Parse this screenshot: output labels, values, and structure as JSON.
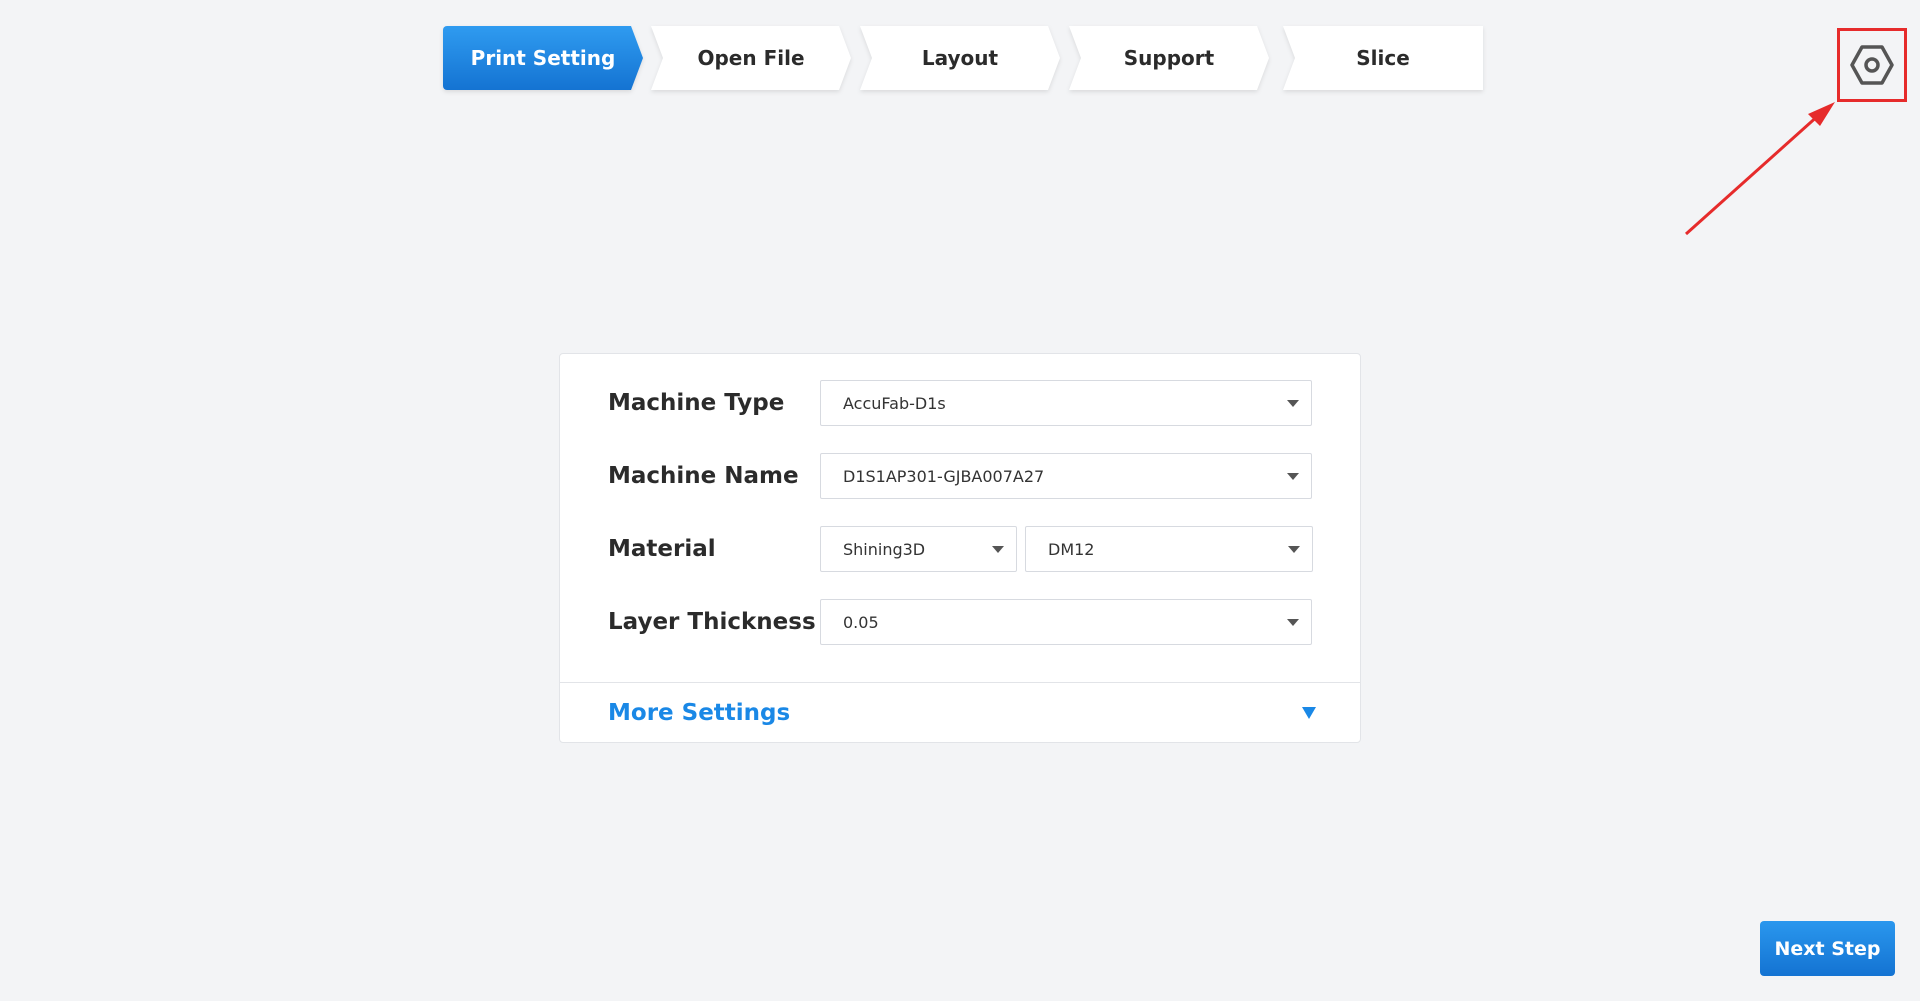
{
  "steps": [
    {
      "label": "Print Setting",
      "active": true
    },
    {
      "label": "Open File",
      "active": false
    },
    {
      "label": "Layout",
      "active": false
    },
    {
      "label": "Support",
      "active": false
    },
    {
      "label": "Slice",
      "active": false
    }
  ],
  "settings_icon": "hexagon-gear-icon",
  "annotation": {
    "highlight_color": "#e62b2b"
  },
  "form": {
    "machine_type": {
      "label": "Machine Type",
      "value": "AccuFab-D1s"
    },
    "machine_name": {
      "label": "Machine Name",
      "value": "D1S1AP301-GJBA007A27"
    },
    "material": {
      "label": "Material",
      "brand": "Shining3D",
      "resin": "DM12"
    },
    "layer_thickness": {
      "label": "Layer Thickness",
      "value": "0.05"
    },
    "more_settings": {
      "label": "More Settings"
    }
  },
  "next_button": {
    "label": "Next Step"
  },
  "colors": {
    "accent": "#1a88e6",
    "background": "#f3f4f6"
  }
}
